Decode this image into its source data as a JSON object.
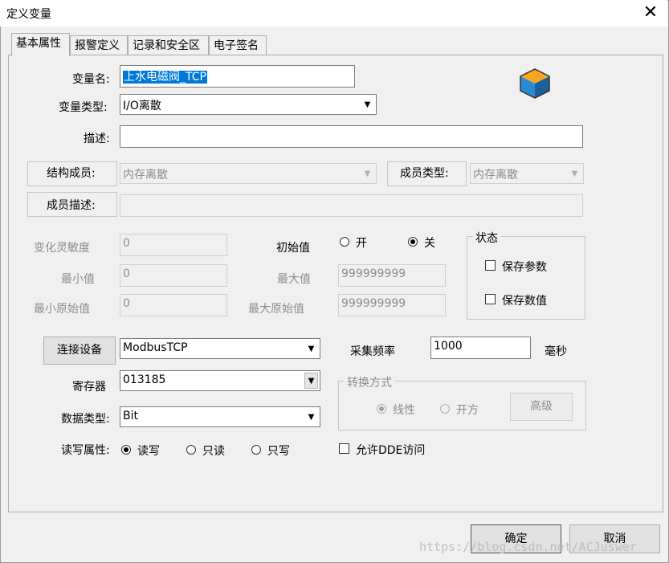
{
  "window": {
    "title": "定义变量"
  },
  "tabs": [
    {
      "label": "基本属性",
      "active": true
    },
    {
      "label": "报警定义",
      "active": false
    },
    {
      "label": "记录和安全区",
      "active": false
    },
    {
      "label": "电子签名",
      "active": false
    }
  ],
  "fields": {
    "var_name_label": "变量名:",
    "var_name_value": "上水电磁阀_TCP",
    "var_type_label": "变量类型:",
    "var_type_value": "I/O离散",
    "desc_label": "描述:",
    "desc_value": "",
    "struct_member_label": "结构成员:",
    "struct_member_value": "内存离散",
    "member_type_label": "成员类型:",
    "member_type_value": "内存离散",
    "member_desc_label": "成员描述:",
    "member_desc_value": "",
    "sensitivity_label": "变化灵敏度",
    "sensitivity_value": "0",
    "min_label": "最小值",
    "min_value": "0",
    "min_raw_label": "最小原始值",
    "min_raw_value": "0",
    "init_label": "初始值",
    "init_on": "开",
    "init_off": "关",
    "max_label": "最大值",
    "max_value": "999999999",
    "max_raw_label": "最大原始值",
    "max_raw_value": "999999999",
    "status_group": "状态",
    "save_param": "保存参数",
    "save_value": "保存数值",
    "connect_device_btn": "连接设备",
    "device_value": "ModbusTCP",
    "sample_freq_label": "采集频率",
    "sample_freq_value": "1000",
    "ms_label": "毫秒",
    "register_label": "寄存器",
    "register_value": "013185",
    "data_type_label": "数据类型:",
    "data_type_value": "Bit",
    "rw_label": "读写属性:",
    "rw_readwrite": "读写",
    "rw_readonly": "只读",
    "rw_writeonly": "只写",
    "convert_group": "转换方式",
    "convert_linear": "线性",
    "convert_sqrt": "开方",
    "advanced_btn": "高级",
    "allow_dde": "允许DDE访问"
  },
  "buttons": {
    "ok": "确定",
    "cancel": "取消"
  },
  "watermark": "https://blog.csdn.net/ACJuswer"
}
